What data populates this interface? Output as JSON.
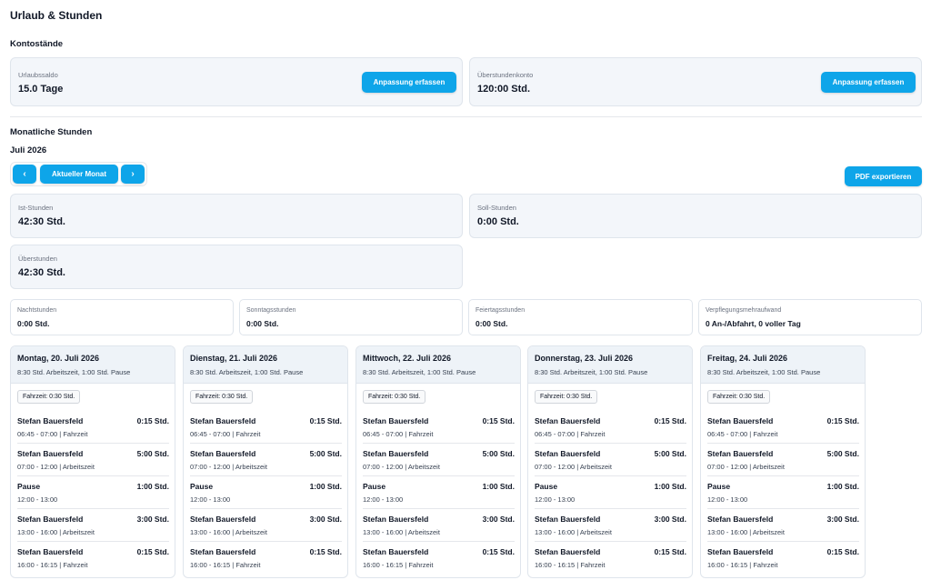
{
  "page_title": "Urlaub & Stunden",
  "kontostaende": {
    "title": "Kontostände",
    "urlaub": {
      "label": "Urlaubssaldo",
      "value": "15.0 Tage",
      "button": "Anpassung erfassen"
    },
    "ueberstunden": {
      "label": "Überstundenkonto",
      "value": "120:00 Std.",
      "button": "Anpassung erfassen"
    }
  },
  "monthly": {
    "title": "Monatliche Stunden",
    "month": "Juli 2026",
    "nav": {
      "prev": "‹",
      "current": "Aktueller Monat",
      "next": "›"
    },
    "export_button": "PDF exportieren",
    "ist": {
      "label": "Ist-Stunden",
      "value": "42:30 Std."
    },
    "soll": {
      "label": "Soll-Stunden",
      "value": "0:00 Std."
    },
    "ueber": {
      "label": "Überstunden",
      "value": "42:30 Std."
    },
    "small": [
      {
        "label": "Nachtstunden",
        "value": "0:00 Std."
      },
      {
        "label": "Sonntagsstunden",
        "value": "0:00 Std."
      },
      {
        "label": "Feiertagsstunden",
        "value": "0:00 Std."
      },
      {
        "label": "Verpflegungsmehraufwand",
        "value": "0 An-/Abfahrt, 0 voller Tag"
      }
    ]
  },
  "days": [
    {
      "title": "Montag, 20. Juli 2026",
      "summary": "8:30 Std. Arbeitszeit, 1:00 Std. Pause",
      "fahrzeit": "Fahrzeit: 0:30 Std.",
      "entries": [
        {
          "name": "Stefan Bauersfeld",
          "duration": "0:15 Std.",
          "detail": "06:45 - 07:00 | Fahrzeit"
        },
        {
          "name": "Stefan Bauersfeld",
          "duration": "5:00 Std.",
          "detail": "07:00 - 12:00 | Arbeitszeit"
        },
        {
          "name": "Pause",
          "duration": "1:00 Std.",
          "detail": "12:00 - 13:00"
        },
        {
          "name": "Stefan Bauersfeld",
          "duration": "3:00 Std.",
          "detail": "13:00 - 16:00 | Arbeitszeit"
        },
        {
          "name": "Stefan Bauersfeld",
          "duration": "0:15 Std.",
          "detail": "16:00 - 16:15 | Fahrzeit"
        }
      ]
    },
    {
      "title": "Dienstag, 21. Juli 2026",
      "summary": "8:30 Std. Arbeitszeit, 1:00 Std. Pause",
      "fahrzeit": "Fahrzeit: 0:30 Std.",
      "entries": [
        {
          "name": "Stefan Bauersfeld",
          "duration": "0:15 Std.",
          "detail": "06:45 - 07:00 | Fahrzeit"
        },
        {
          "name": "Stefan Bauersfeld",
          "duration": "5:00 Std.",
          "detail": "07:00 - 12:00 | Arbeitszeit"
        },
        {
          "name": "Pause",
          "duration": "1:00 Std.",
          "detail": "12:00 - 13:00"
        },
        {
          "name": "Stefan Bauersfeld",
          "duration": "3:00 Std.",
          "detail": "13:00 - 16:00 | Arbeitszeit"
        },
        {
          "name": "Stefan Bauersfeld",
          "duration": "0:15 Std.",
          "detail": "16:00 - 16:15 | Fahrzeit"
        }
      ]
    },
    {
      "title": "Mittwoch, 22. Juli 2026",
      "summary": "8:30 Std. Arbeitszeit, 1:00 Std. Pause",
      "fahrzeit": "Fahrzeit: 0:30 Std.",
      "entries": [
        {
          "name": "Stefan Bauersfeld",
          "duration": "0:15 Std.",
          "detail": "06:45 - 07:00 | Fahrzeit"
        },
        {
          "name": "Stefan Bauersfeld",
          "duration": "5:00 Std.",
          "detail": "07:00 - 12:00 | Arbeitszeit"
        },
        {
          "name": "Pause",
          "duration": "1:00 Std.",
          "detail": "12:00 - 13:00"
        },
        {
          "name": "Stefan Bauersfeld",
          "duration": "3:00 Std.",
          "detail": "13:00 - 16:00 | Arbeitszeit"
        },
        {
          "name": "Stefan Bauersfeld",
          "duration": "0:15 Std.",
          "detail": "16:00 - 16:15 | Fahrzeit"
        }
      ]
    },
    {
      "title": "Donnerstag, 23. Juli 2026",
      "summary": "8:30 Std. Arbeitszeit, 1:00 Std. Pause",
      "fahrzeit": "Fahrzeit: 0:30 Std.",
      "entries": [
        {
          "name": "Stefan Bauersfeld",
          "duration": "0:15 Std.",
          "detail": "06:45 - 07:00 | Fahrzeit"
        },
        {
          "name": "Stefan Bauersfeld",
          "duration": "5:00 Std.",
          "detail": "07:00 - 12:00 | Arbeitszeit"
        },
        {
          "name": "Pause",
          "duration": "1:00 Std.",
          "detail": "12:00 - 13:00"
        },
        {
          "name": "Stefan Bauersfeld",
          "duration": "3:00 Std.",
          "detail": "13:00 - 16:00 | Arbeitszeit"
        },
        {
          "name": "Stefan Bauersfeld",
          "duration": "0:15 Std.",
          "detail": "16:00 - 16:15 | Fahrzeit"
        }
      ]
    },
    {
      "title": "Freitag, 24. Juli 2026",
      "summary": "8:30 Std. Arbeitszeit, 1:00 Std. Pause",
      "fahrzeit": "Fahrzeit: 0:30 Std.",
      "entries": [
        {
          "name": "Stefan Bauersfeld",
          "duration": "0:15 Std.",
          "detail": "06:45 - 07:00 | Fahrzeit"
        },
        {
          "name": "Stefan Bauersfeld",
          "duration": "5:00 Std.",
          "detail": "07:00 - 12:00 | Arbeitszeit"
        },
        {
          "name": "Pause",
          "duration": "1:00 Std.",
          "detail": "12:00 - 13:00"
        },
        {
          "name": "Stefan Bauersfeld",
          "duration": "3:00 Std.",
          "detail": "13:00 - 16:00 | Arbeitszeit"
        },
        {
          "name": "Stefan Bauersfeld",
          "duration": "0:15 Std.",
          "detail": "16:00 - 16:15 | Fahrzeit"
        }
      ]
    }
  ]
}
